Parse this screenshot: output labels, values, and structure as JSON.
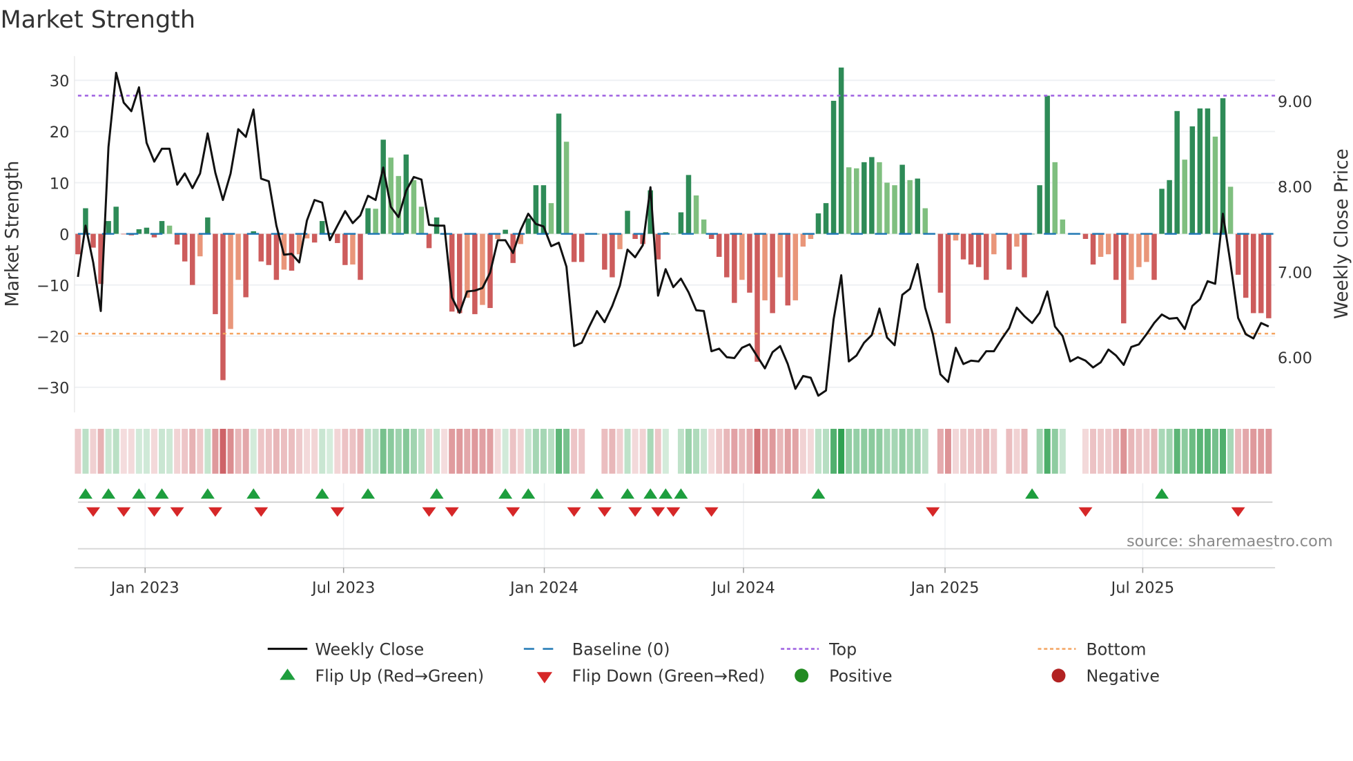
{
  "chart_data": {
    "type": "bar",
    "title": "Market Strength",
    "ylabel": "Market Strength",
    "ylabel_right": "Weekly Close Price",
    "ylim": [
      -35,
      35
    ],
    "ylim_right": [
      5.35,
      9.53
    ],
    "yticks": [
      30,
      20,
      10,
      0,
      -10,
      -20,
      -30
    ],
    "yticks_labels": [
      "30",
      "20",
      "10",
      "0",
      "−10",
      "−20",
      "−30"
    ],
    "yticks_right": [
      9,
      8,
      7,
      6
    ],
    "yticks_right_labels": [
      "9.00",
      "8.00",
      "7.00",
      "6.00"
    ],
    "xticks": [
      {
        "label": "Jan 2023",
        "week": 9.8
      },
      {
        "label": "Jul 2023",
        "week": 35.8
      },
      {
        "label": "Jan 2024",
        "week": 62.1
      },
      {
        "label": "Jul 2024",
        "week": 88.2
      },
      {
        "label": "Jan 2025",
        "week": 114.6
      },
      {
        "label": "Jul 2025",
        "week": 140.5
      }
    ],
    "top_level": 27,
    "bottom_level": -19.5,
    "baseline": 0,
    "grid": true,
    "legend_position": "bottom",
    "strength": [
      -4.0,
      5.0,
      -2.7,
      -9.8,
      2.5,
      5.3,
      -0.1,
      -0.3,
      0.9,
      1.2,
      -0.7,
      2.5,
      1.6,
      -2.1,
      -5.4,
      -10,
      -4.4,
      3.2,
      -15.7,
      -28.6,
      -18.6,
      -9.0,
      -12.4,
      0.5,
      -5.4,
      -6.1,
      -9.0,
      -7.0,
      -7.2,
      -4.0,
      -0.9,
      -1.7,
      2.5,
      0.2,
      -1.8,
      -6.1,
      -6.0,
      -9.0,
      5.0,
      4.9,
      18.4,
      14.9,
      11.3,
      15.5,
      10.5,
      5.3,
      -2.8,
      3.2,
      -0.2,
      -15.2,
      -15.5,
      -12.5,
      -15.7,
      -13.9,
      -14.5,
      -1.0,
      0.8,
      -5.7,
      -2.0,
      3.0,
      9.5,
      9.5,
      6,
      23.5,
      18,
      -5.5,
      -5.5,
      0,
      0,
      -7,
      -8.5,
      -3,
      4.5,
      -1,
      -2,
      8.5,
      -5,
      0.3,
      0,
      4.2,
      11.5,
      7.5,
      2.8,
      -1,
      -4.5,
      -8.5,
      -13.5,
      -9,
      -11.5,
      -25,
      -13,
      -15.5,
      -8.5,
      -14,
      -13,
      -2.5,
      -1,
      4,
      6,
      26,
      32.5,
      13,
      12.8,
      14,
      15,
      14,
      10,
      9.5,
      13.5,
      10.5,
      10.8,
      5,
      0,
      -11.5,
      -17.5,
      -1.3,
      -5,
      -6,
      -6.5,
      -9,
      -4,
      0,
      -7,
      -2.5,
      -8.5,
      0,
      9.5,
      27,
      14,
      2.8,
      0,
      0,
      -1,
      -6,
      -4.5,
      -4,
      -9,
      -17.5,
      -9,
      -6.5,
      -5.5,
      -9,
      8.8,
      10.5,
      24,
      14.5,
      21,
      24.5,
      24.5,
      19,
      26.5,
      9.2,
      -8,
      -12.5,
      -15.5,
      -15.5,
      -16.5
    ],
    "weekly_close": [
      6.94,
      7.54,
      7.11,
      6.54,
      8.46,
      9.33,
      8.98,
      8.88,
      9.16,
      8.51,
      8.29,
      8.44,
      8.44,
      8.02,
      8.15,
      7.98,
      8.15,
      8.62,
      8.16,
      7.84,
      8.15,
      8.67,
      8.58,
      8.9,
      8.09,
      8.06,
      7.54,
      7.2,
      7.21,
      7.11,
      7.6,
      7.84,
      7.81,
      7.37,
      7.54,
      7.71,
      7.57,
      7.66,
      7.89,
      7.84,
      8.22,
      7.76,
      7.64,
      7.95,
      8.11,
      8.08,
      7.55,
      7.54,
      7.54,
      6.7,
      6.52,
      6.77,
      6.78,
      6.81,
      6.99,
      7.37,
      7.37,
      7.22,
      7.49,
      7.68,
      7.56,
      7.53,
      7.3,
      7.34,
      7.06,
      6.13,
      6.17,
      6.36,
      6.54,
      6.41,
      6.6,
      6.84,
      7.26,
      7.17,
      7.31,
      7.99,
      6.72,
      7.03,
      6.82,
      6.92,
      6.76,
      6.55,
      6.54,
      6.07,
      6.1,
      6.0,
      5.99,
      6.11,
      6.15,
      6.01,
      5.87,
      6.06,
      6.13,
      5.92,
      5.63,
      5.78,
      5.76,
      5.55,
      5.61,
      6.44,
      6.96,
      5.95,
      6.02,
      6.17,
      6.26,
      6.57,
      6.23,
      6.14,
      6.73,
      6.8,
      7.09,
      6.58,
      6.27,
      5.8,
      5.71,
      6.11,
      5.92,
      5.96,
      5.95,
      6.07,
      6.07,
      6.21,
      6.34,
      6.58,
      6.48,
      6.4,
      6.52,
      6.77,
      6.36,
      6.25,
      5.95,
      6.0,
      5.96,
      5.88,
      5.94,
      6.09,
      6.02,
      5.91,
      6.12,
      6.15,
      6.27,
      6.4,
      6.5,
      6.45,
      6.46,
      6.33,
      6.6,
      6.68,
      6.89,
      6.86,
      7.68,
      7.1,
      6.46,
      6.27,
      6.22,
      6.4,
      6.36
    ],
    "flip_up_weeks": [
      2,
      5,
      9,
      12,
      18,
      24,
      33,
      39,
      48,
      57,
      60,
      69,
      73,
      76,
      78,
      80,
      98,
      126,
      143
    ],
    "flip_down_weeks": [
      3,
      7,
      11,
      14,
      19,
      25,
      35,
      47,
      50,
      58,
      66,
      70,
      74,
      77,
      79,
      84,
      113,
      133,
      153
    ],
    "legend": {
      "weekly_close": "Weekly Close",
      "baseline": "Baseline (0)",
      "top": "Top",
      "bottom": "Bottom",
      "flip_up": "Flip Up (Red→Green)",
      "flip_down": "Flip Down (Green→Red)",
      "positive": "Positive",
      "negative": "Negative"
    },
    "source": "source: sharemaestro.com",
    "colors": {
      "pos_rising": "#2e8b57",
      "pos_falling": "#7fbf7f",
      "neg_falling": "#cd5c5c",
      "neg_rising": "#e9967a",
      "line": "#111111",
      "baseline": "#1f77b4",
      "top": "#9d5fe0",
      "bottom": "#f4a460",
      "flip_up": "#1e9e3e",
      "flip_down": "#d62728",
      "positive": "#228b22",
      "negative": "#b22222"
    }
  }
}
